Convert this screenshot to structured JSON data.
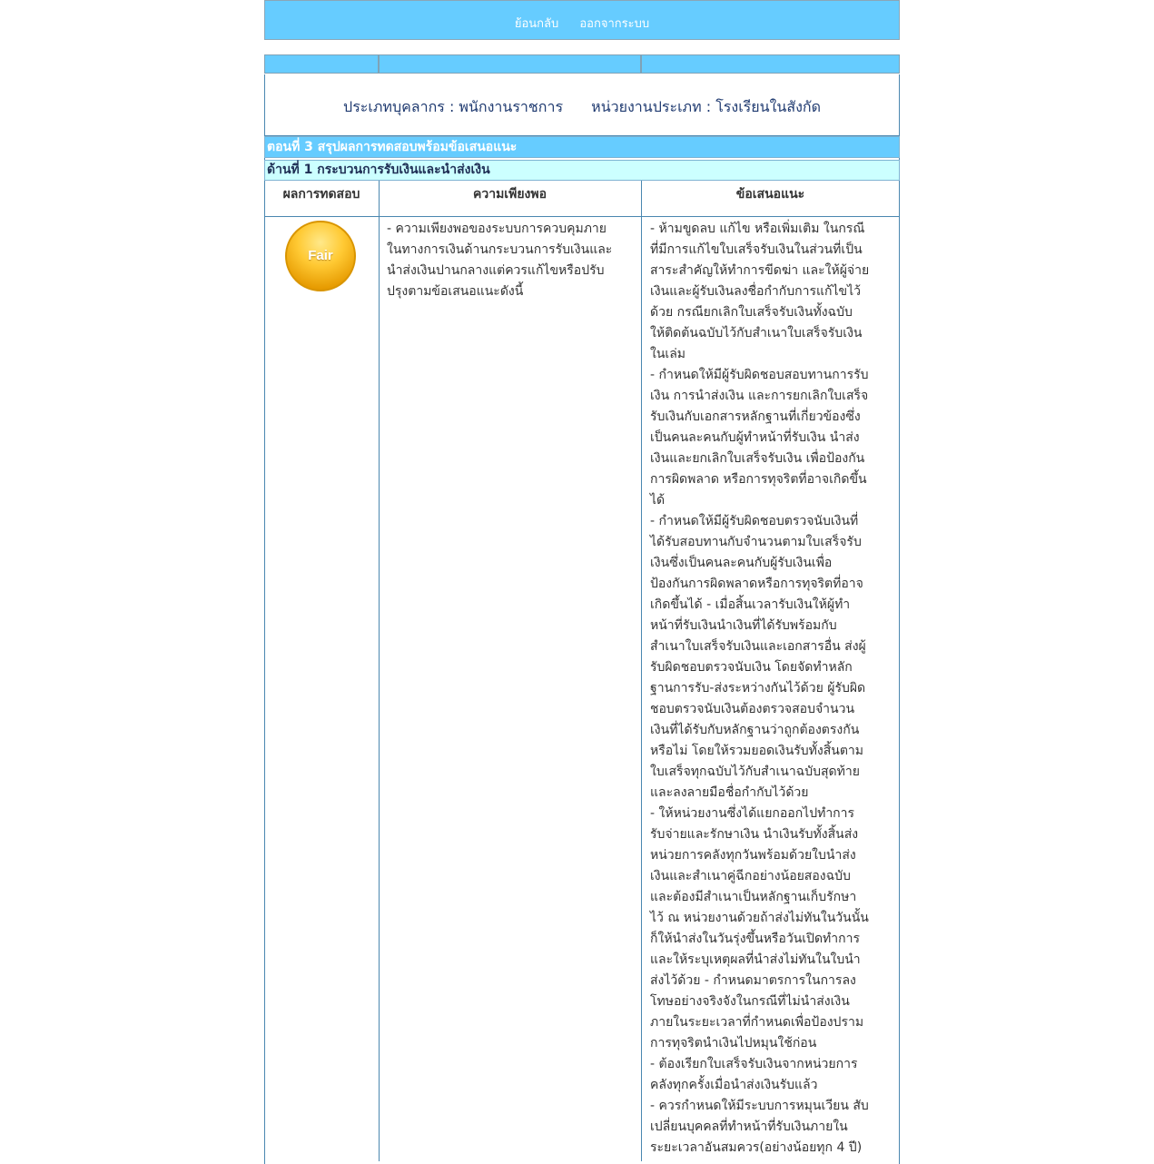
{
  "nav": {
    "back_label": "ย้อนกลับ",
    "logout_label": "ออกจากระบบ"
  },
  "heading": {
    "personnel_type": "ประเภทบุคลากร : พนักงานราชการ",
    "unit_type": "หน่วยงานประเภท : โรงเรียนในสังกัด"
  },
  "section": {
    "part_title": "ตอนที่ 3 สรุปผลการทดสอบพร้อมข้อเสนอแนะ",
    "aspect_title": "ด้านที่ 1 กระบวนการรับเงินและนำส่งเงิน"
  },
  "table": {
    "headers": [
      "ผลการทดสอบ",
      "ความเพียงพอ",
      "ข้อเสนอแนะ"
    ],
    "result_badge": "Fair",
    "adequacy_lines": [
      "- ความเพียงพอของระบบการควบคุมภาย",
      "ในทางการเงินด้านกระบวนการรับเงินและ",
      "นำส่งเงินปานกลางแต่ควรแก้ไขหรือปรับ",
      "ปรุงตามข้อเสนอแนะดังนี้"
    ],
    "recommendation_lines": [
      "- ห้ามขูดลบ แก้ไข หรือเพิ่มเติม ในกรณี",
      "ที่มีการแก้ไขใบเสร็จรับเงินในส่วนที่เป็น",
      "สาระสำคัญให้ทำการขีดฆ่า และให้ผู้จ่าย",
      "เงินและผู้รับเงินลงชื่อกำกับการแก้ไขไว้",
      "ด้วย กรณียกเลิกใบเสร็จรับเงินทั้งฉบับ",
      "ให้ติดต้นฉบับไว้กับสำเนาใบเสร็จรับเงิน",
      "ในเล่ม",
      "- กำหนดให้มีผู้รับผิดชอบสอบทานการรับ",
      "เงิน การนำส่งเงิน และการยกเลิกใบเสร็จ",
      "รับเงินกับเอกสารหลักฐานที่เกี่ยวข้องซึ่ง",
      "เป็นคนละคนกับผู้ทำหน้าที่รับเงิน นำส่ง",
      "เงินและยกเลิกใบเสร็จรับเงิน เพื่อป้องกัน",
      "การผิดพลาด หรือการทุจริตที่อาจเกิดขึ้น",
      "ได้",
      "- กำหนดให้มีผู้รับผิดชอบตรวจนับเงินที่",
      "ได้รับสอบทานกับจำนวนตามใบเสร็จรับ",
      "เงินซึ่งเป็นคนละคนกับผู้รับเงินเพื่อ",
      "ป้องกันการผิดพลาดหรือการทุจริตที่อาจ",
      "เกิดขึ้นได้ - เมื่อสิ้นเวลารับเงินให้ผู้ทำ",
      "หน้าที่รับเงินนำเงินที่ได้รับพร้อมกับ",
      "สำเนาใบเสร็จรับเงินและเอกสารอื่น ส่งผู้",
      "รับผิดชอบตรวจนับเงิน โดยจัดทำหลัก",
      "ฐานการรับ-ส่งระหว่างกันไว้ด้วย ผู้รับผิด",
      "ชอบตรวจนับเงินต้องตรวจสอบจำนวน",
      "เงินที่ได้รับกับหลักฐานว่าถูกต้องตรงกัน",
      "หรือไม่ โดยให้รวมยอดเงินรับทั้งสิ้นตาม",
      "ใบเสร็จทุกฉบับไว้กับสำเนาฉบับสุดท้าย",
      "และลงลายมือชื่อกำกับไว้ด้วย",
      "- ให้หน่วยงานซึ่งได้แยกออกไปทำการ",
      "รับจ่ายและรักษาเงิน นำเงินรับทั้งสิ้นส่ง",
      "หน่วยการคลังทุกวันพร้อมด้วยใบนำส่ง",
      "เงินและสำเนาคู่ฉีกอย่างน้อยสองฉบับ",
      "และต้องมีสำเนาเป็นหลักฐานเก็บรักษา",
      "ไว้ ณ หน่วยงานด้วยถ้าส่งไม่ทันในวันนั้น",
      "ก็ให้นำส่งในวันรุ่งขึ้นหรือวันเปิดทำการ",
      "และให้ระบุเหตุผลที่นำส่งไม่ทันในใบนำ",
      "ส่งไว้ด้วย - กำหนดมาตรการในการลง",
      "โทษอย่างจริงจังในกรณีที่ไม่นำส่งเงิน",
      "ภายในระยะเวลาที่กำหนดเพื่อป้องปราม",
      "การทุจริตนำเงินไปหมุนใช้ก่อน",
      "- ต้องเรียกใบเสร็จรับเงินจากหน่วยการ",
      "คลังทุกครั้งเมื่อนำส่งเงินรับแล้ว",
      "- ควรกำหนดให้มีระบบการหมุนเวียน สับ",
      "เปลี่ยนบุคคลที่ทำหน้าที่รับเงินภายใน",
      "ระยะเวลาอันสมควร(อย่างน้อยทุก 4 ปี)"
    ]
  }
}
